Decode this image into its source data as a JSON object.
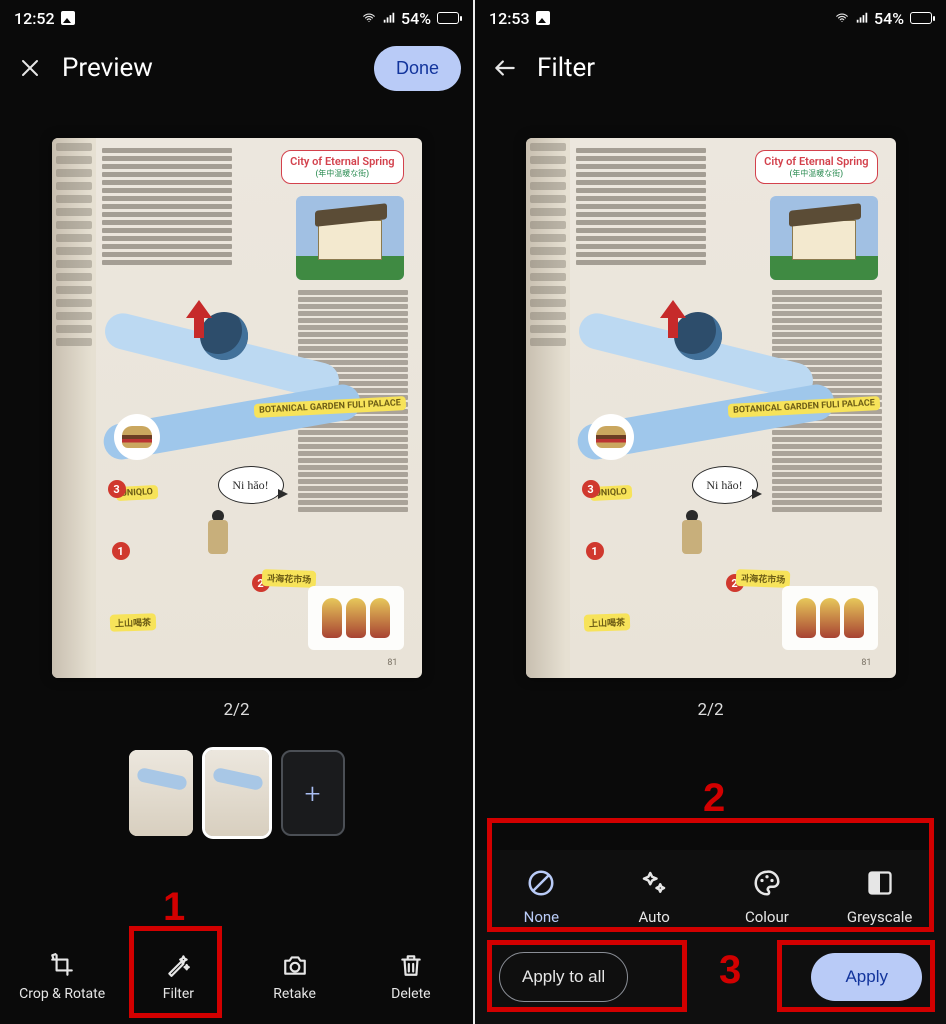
{
  "left": {
    "status": {
      "time": "12:52",
      "battery_text": "54%"
    },
    "appbar": {
      "title": "Preview",
      "done": "Done"
    },
    "page": {
      "counter": "2/2",
      "badge_title": "City of Eternal Spring",
      "badge_sub": "(年中温暖な街)",
      "bubble": "Ni hăo!",
      "label_botanical": "BOTANICAL GARDEN\nFULI PALACE",
      "label_uniqlo": "UNIQLO",
      "label_market": "과海花市场",
      "label_tea": "上山喝茶",
      "page_no": "81"
    },
    "bottom": {
      "crop": "Crop & Rotate",
      "filter": "Filter",
      "retake": "Retake",
      "delete": "Delete"
    },
    "annotation": {
      "num1": "1"
    }
  },
  "right": {
    "status": {
      "time": "12:53",
      "battery_text": "54%"
    },
    "appbar": {
      "title": "Filter"
    },
    "page": {
      "counter": "2/2"
    },
    "filters": {
      "none": "None",
      "auto": "Auto",
      "colour": "Colour",
      "greyscale": "Greyscale"
    },
    "actions": {
      "apply_all": "Apply to all",
      "apply": "Apply"
    },
    "annotation": {
      "num2": "2",
      "num3": "3"
    }
  }
}
